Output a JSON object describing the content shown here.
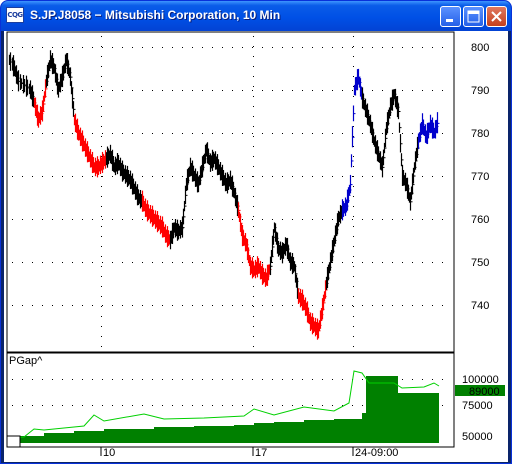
{
  "window": {
    "app_icon_text": "CQG",
    "title": "S.JP.J8058 − Mitsubishi Corporation, 10 Min"
  },
  "price_axis": {
    "ticks": [
      "800",
      "790",
      "780",
      "770",
      "760",
      "750",
      "740"
    ]
  },
  "study": {
    "label": "PGap^",
    "ticks": [
      "100000",
      "75000",
      "50000"
    ],
    "current_value": "89000",
    "current_value_bg": "#008000",
    "fill_color": "#008000",
    "line_color": "#00d000"
  },
  "date_axis": {
    "labels": [
      "10",
      "17",
      "24-09:00"
    ]
  },
  "colors": {
    "up": "#000000",
    "down": "#ff0000",
    "blue": "#0000cc"
  }
}
